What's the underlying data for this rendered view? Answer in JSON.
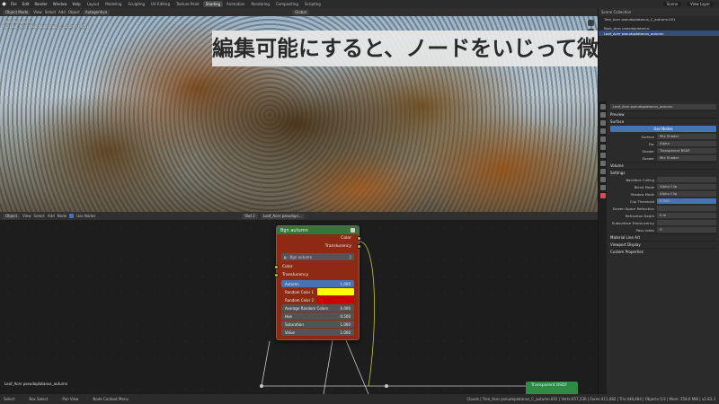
{
  "topbar": {
    "menus": [
      "File",
      "Edit",
      "Render",
      "Window",
      "Help"
    ],
    "workspaces": [
      "Layout",
      "Modeling",
      "Sculpting",
      "UV Editing",
      "Texture Paint",
      "Shading",
      "Animation",
      "Rendering",
      "Compositing",
      "Scripting"
    ],
    "active_workspace": "Shading",
    "scene": "Scene",
    "view_layer": "View Layer"
  },
  "viewport_header": {
    "mode": "Object Mode",
    "menus": [
      "View",
      "Select",
      "Add",
      "Object"
    ],
    "shading_label": "Autogentive",
    "transform": "Global"
  },
  "viewport": {
    "info_line1": "User Perspective",
    "info_line2": "(1) Leaf_Acer pseudoplatanus_C_autumn (001)"
  },
  "caption": "編集可能にすると、ノードをいじって微調整が可能",
  "node_editor_header": {
    "editor": "Object",
    "menus": [
      "View",
      "Select",
      "Add",
      "Node"
    ],
    "use_nodes": "Use Nodes",
    "slot": "Slot 2",
    "material": "Leaf_Acer pseudopl..."
  },
  "group_node": {
    "title": "Bgn autumn",
    "outputs": [
      "Color",
      "Translucency"
    ],
    "tree_name": "Bgn autumn",
    "tree_users": "2",
    "inputs": [
      "Color",
      "Translucency"
    ],
    "fields": {
      "autumn_label": "Autumn",
      "autumn_value": "1.000",
      "autumn_fill": 1.0,
      "random_color_1_label": "Random Color 1",
      "random_color_1": "#ffff00",
      "random_color_2_label": "Random Color 2",
      "random_color_2": "#cc0000",
      "avg_label": "Average Random Colors",
      "avg_value": "0.000",
      "hue_label": "Hue",
      "hue_value": "0.500",
      "saturation_label": "Saturation",
      "saturation_value": "1.000",
      "value_label": "Value",
      "value_value": "1.000"
    }
  },
  "bsdf_node": {
    "title": "Transparent BSDF"
  },
  "breadcrumb": "Leaf_Acer pseudoplatanus_autumn",
  "outliner": {
    "title": "Scene Collection",
    "items": [
      "Tree_Acer pseudoplatanus_C_autumn.001",
      "Bark_Acer pseudoplatanus",
      "Leaf_Acer pseudoplatanus_autumn"
    ],
    "active_index": 2
  },
  "properties": {
    "material_name": "Leaf_Acer pseudoplatanus_autumn",
    "sections": {
      "preview": "Preview",
      "surface": "Surface",
      "volume": "Volume",
      "settings": "Settings",
      "lineart": "Material Line Art",
      "viewport_display": "Viewport Display",
      "custom_props": "Custom Properties"
    },
    "use_nodes": "Use Nodes",
    "surface_rows": [
      {
        "k": "Surface",
        "v": "Mix Shader"
      },
      {
        "k": "Fac",
        "v": "Alpha"
      },
      {
        "k": "Shader",
        "v": "Transparent BSDF"
      },
      {
        "k": "Shader",
        "v": "Mix Shader"
      }
    ],
    "settings_rows": [
      {
        "k": "Backface Culling",
        "v": ""
      },
      {
        "k": "Blend Mode",
        "v": "Alpha Clip"
      },
      {
        "k": "Shadow Mode",
        "v": "Alpha Clip"
      },
      {
        "k": "Clip Threshold",
        "v": "0.500"
      },
      {
        "k": "Screen Space Refraction",
        "v": ""
      },
      {
        "k": "Refraction Depth",
        "v": "0 m"
      },
      {
        "k": "Subsurface Translucency",
        "v": ""
      },
      {
        "k": "Pass Index",
        "v": "0"
      }
    ]
  },
  "statusbar": {
    "items": [
      "Select",
      "Box Select",
      "Pan View",
      "Node Context Menu"
    ],
    "stats": "Clouds | Tree_Acer pseudoplatanus_C_autumn.001 | Verts:657,236 | Faces:411,082 | Tris:448,484 | Objects:1/3 | Mem: 258.6 MiB | v2.83.3"
  }
}
